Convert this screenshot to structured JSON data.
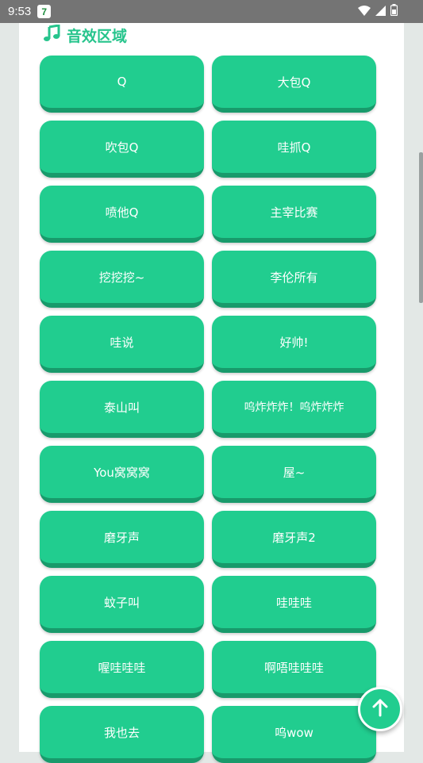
{
  "status_bar": {
    "time": "9:53",
    "notification_badge": "7",
    "icons": [
      "wifi-icon",
      "signal-icon",
      "battery-icon"
    ]
  },
  "section": {
    "title": "音效区域",
    "icon": "music-note-icon",
    "accent_color": "#26c48c"
  },
  "sound_buttons": [
    {
      "label": "Q"
    },
    {
      "label": "大包Q"
    },
    {
      "label": "吹包Q"
    },
    {
      "label": "哇抓Q"
    },
    {
      "label": "喷他Q"
    },
    {
      "label": "主宰比赛"
    },
    {
      "label": "挖挖挖~"
    },
    {
      "label": "李伦所有"
    },
    {
      "label": "哇说"
    },
    {
      "label": "好帅!"
    },
    {
      "label": "泰山叫"
    },
    {
      "label": "呜炸炸炸！呜炸炸炸"
    },
    {
      "label": "You窝窝窝"
    },
    {
      "label": "屋~"
    },
    {
      "label": "磨牙声"
    },
    {
      "label": "磨牙声2"
    },
    {
      "label": "蚊子叫"
    },
    {
      "label": "哇哇哇"
    },
    {
      "label": "喔哇哇哇"
    },
    {
      "label": "啊唔哇哇哇"
    },
    {
      "label": "我也去"
    },
    {
      "label": "呜wow"
    }
  ],
  "fab": {
    "icon": "arrow-up-icon"
  },
  "colors": {
    "button": "#21cd8f",
    "button_shadow": "#189a6b",
    "status_bar": "#747474"
  }
}
